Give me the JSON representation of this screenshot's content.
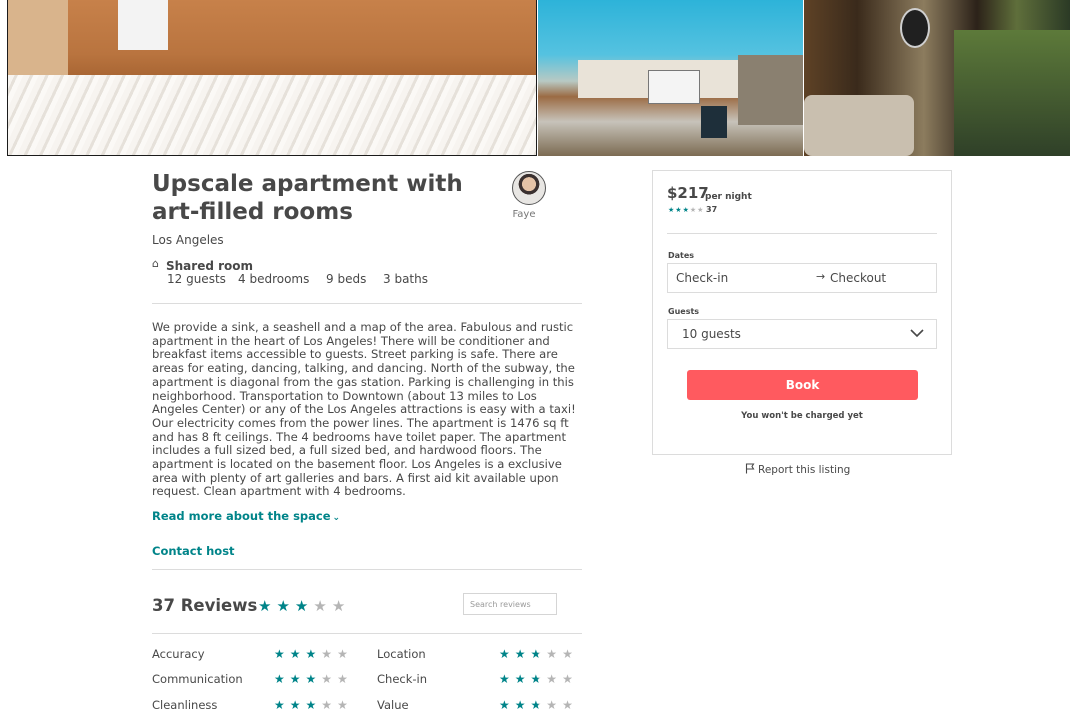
{
  "listing": {
    "title": "Upscale apartment with art-filled rooms",
    "location": "Los Angeles",
    "room_type": "Shared room",
    "amenities": [
      "12 guests",
      "4 bedrooms",
      "9 beds",
      "3 baths"
    ],
    "description": "We provide a sink, a seashell and a map of the area. Fabulous and rustic apartment in the heart of Los Angeles! There will be conditioner and breakfast items accessible to guests. Street parking is safe. There are areas for eating, dancing, talking, and dancing. North of the subway, the apartment is diagonal from the gas station. Parking is challenging in this neighborhood. Transportation to Downtown (about 13 miles to Los Angeles Center) or any of the Los Angeles attractions is easy with a taxi! Our electricity comes from the power lines. The apartment is 1476 sq ft and has 8 ft ceilings. The 4 bedrooms have toilet paper. The apartment includes a full sized bed, a full sized bed, and hardwood floors. The apartment is located on the basement floor. Los Angeles is a exclusive area with plenty of art galleries and bars. A first aid kit available upon request. Clean apartment with 4 bedrooms.",
    "read_more": "Read more about the space",
    "contact_host": "Contact host"
  },
  "host": {
    "name": "Faye"
  },
  "reviews": {
    "title": "37 Reviews",
    "overall_rating": 3,
    "max_rating": 5,
    "search_placeholder": "Search reviews",
    "categories": [
      {
        "label": "Accuracy",
        "rating": 3
      },
      {
        "label": "Location",
        "rating": 2.5
      },
      {
        "label": "Communication",
        "rating": 3
      },
      {
        "label": "Check-in",
        "rating": 2.5
      },
      {
        "label": "Cleanliness",
        "rating": 3
      },
      {
        "label": "Value",
        "rating": 2.5
      }
    ]
  },
  "booking": {
    "price": "$217",
    "per_night": "per night",
    "rating": 3,
    "review_count": "37",
    "dates_label": "Dates",
    "checkin_placeholder": "Check-in",
    "checkout_placeholder": "Checkout",
    "guests_label": "Guests",
    "guests_value": "10 guests",
    "book_label": "Book",
    "charge_note": "You won't be charged yet",
    "report_label": "Report this listing"
  },
  "icons": {
    "room": "house-icon",
    "arrow": "arrow-right-icon",
    "dropdown": "chevron-down-icon",
    "flag": "flag-icon",
    "star": "star-icon"
  },
  "colors": {
    "accent": "#008489",
    "book_button": "#ff5a5f",
    "star_off": "#b5b5b5",
    "text": "#484848"
  }
}
